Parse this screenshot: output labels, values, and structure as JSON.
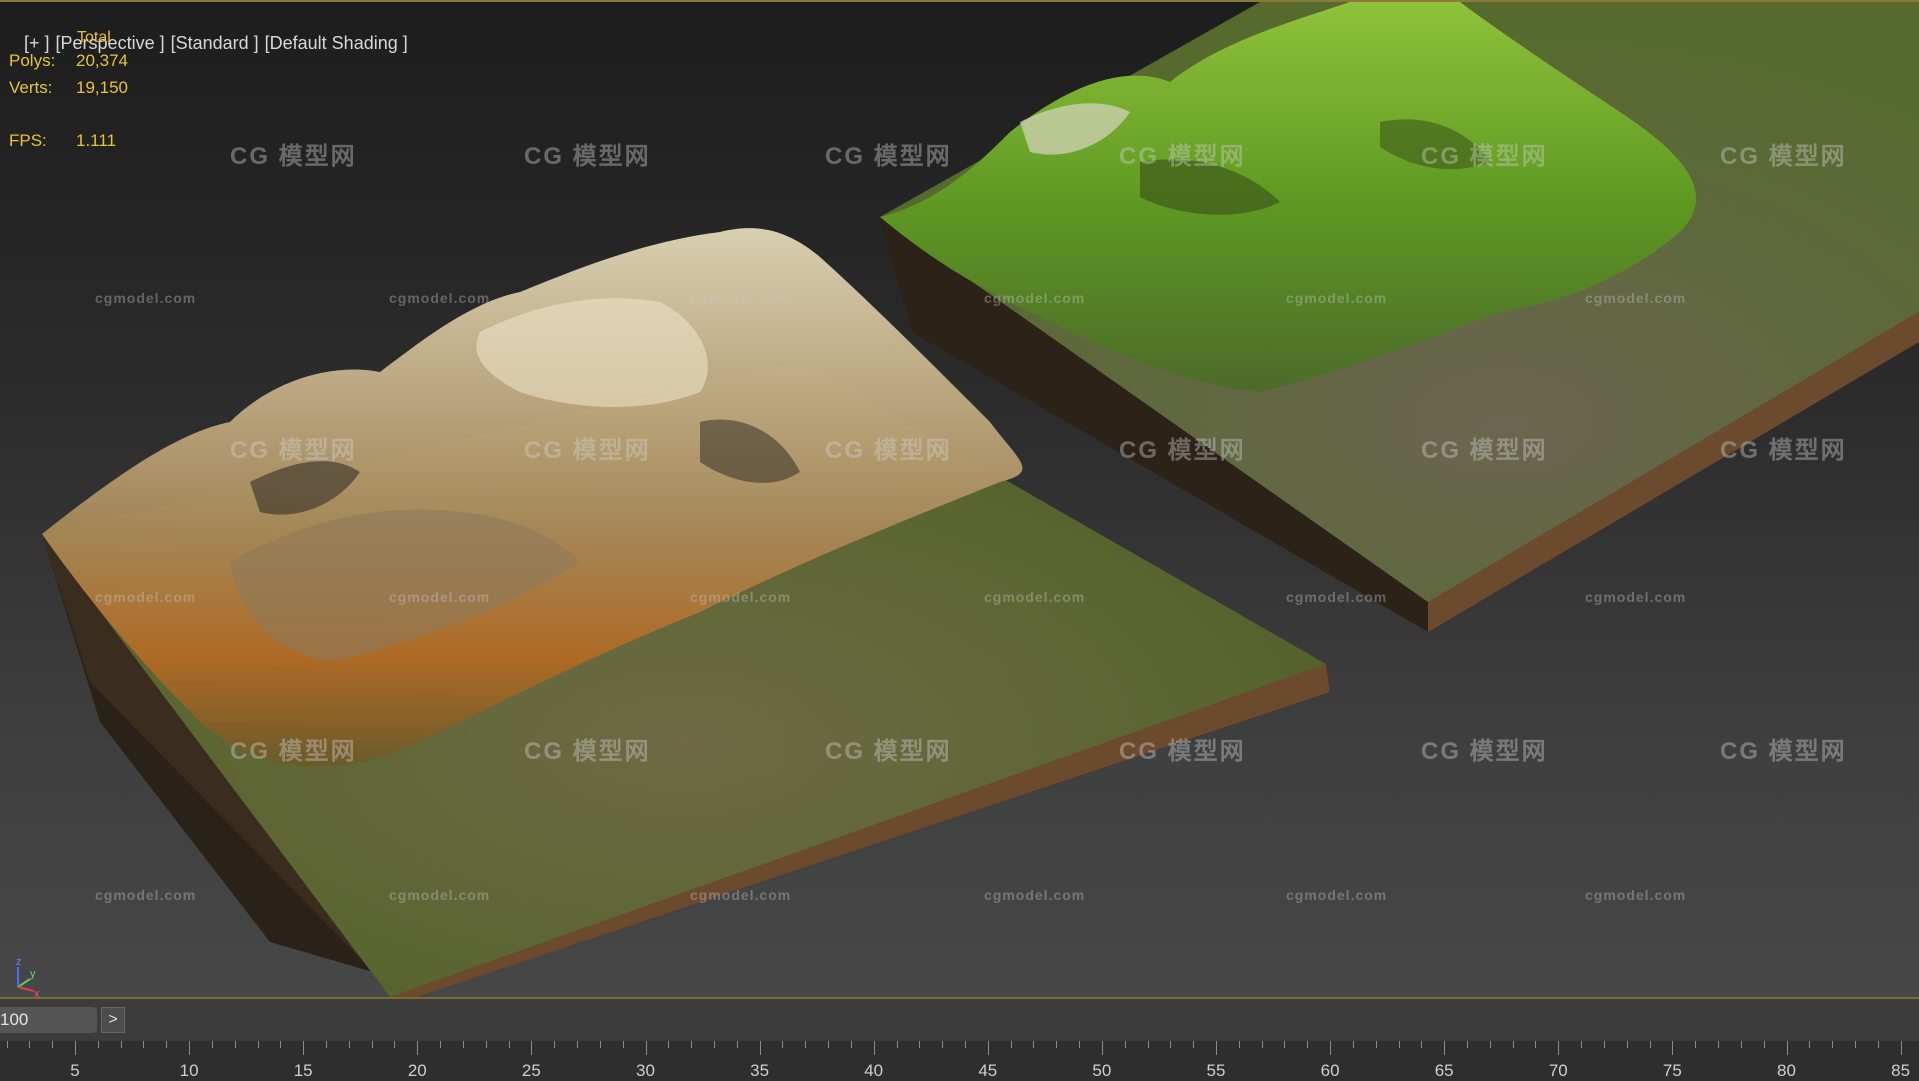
{
  "viewport": {
    "labels": [
      "[+ ]",
      "[Perspective ]",
      "[Standard ]",
      "[Default Shading ]"
    ],
    "stats": {
      "total_label": "Total",
      "polys_label": "Polys:",
      "polys_value": "20,374",
      "verts_label": "Verts:",
      "verts_value": "19,150",
      "fps_label": "FPS:",
      "fps_value": "1.111"
    },
    "axis": {
      "z": "z",
      "y": "y",
      "x": "x"
    }
  },
  "watermarks": {
    "site": "cgmodel.com",
    "logo": "CG 模型网"
  },
  "timeline": {
    "frame_value": "100",
    "next_label": ">",
    "ticks": [
      "5",
      "10",
      "15",
      "20",
      "25",
      "30",
      "35",
      "40",
      "45",
      "50",
      "55",
      "60",
      "65",
      "70",
      "75",
      "80",
      "85"
    ]
  },
  "colors": {
    "stats_text": "#e8c23a",
    "accent_line": "#8a7a3a",
    "grass": "#5f6b2e",
    "rock": "#c9b58a",
    "moss": "#5c8f1f"
  }
}
